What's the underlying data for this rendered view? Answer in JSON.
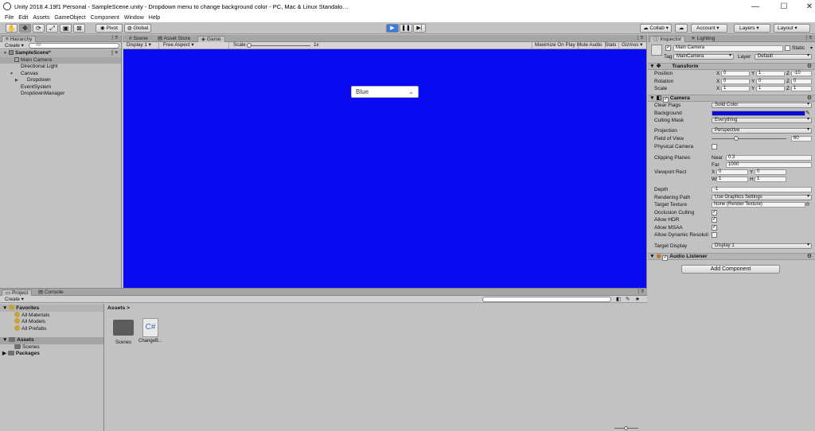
{
  "window": {
    "title": "Unity 2018.4.19f1 Personal - SampleScene.unity - Dropdown menu to change background color - PC, Mac & Linux Standalone* <DX11>",
    "minimize": "—",
    "maximize": "☐",
    "close": "✕"
  },
  "menu": [
    "File",
    "Edit",
    "Assets",
    "GameObject",
    "Component",
    "Window",
    "Help"
  ],
  "toolbar": {
    "pivot": "Pivot",
    "global": "Global",
    "collab": "Collab ▾",
    "account": "Account",
    "layers": "Layers",
    "layout": "Layout",
    "tools": [
      "hand-icon",
      "move-icon",
      "rotate-icon",
      "scale-icon",
      "rect-icon",
      "transform-icon"
    ]
  },
  "hierarchy": {
    "tab": "Hierarchy",
    "create": "Create ▾",
    "search_placeholder": "All",
    "items": [
      {
        "label": "SampleScene*",
        "indent": 0,
        "type": "scene"
      },
      {
        "label": "Main Camera",
        "indent": 1,
        "type": "selected"
      },
      {
        "label": "Directional Light",
        "indent": 1,
        "type": "normal"
      },
      {
        "label": "Canvas",
        "indent": 1,
        "type": "normal"
      },
      {
        "label": "Dropdown",
        "indent": 2,
        "type": "normal"
      },
      {
        "label": "EventSystem",
        "indent": 1,
        "type": "normal"
      },
      {
        "label": "DropdownManager",
        "indent": 1,
        "type": "normal"
      }
    ]
  },
  "scene_tabs": {
    "scene": "Scene",
    "asset_store": "Asset Store",
    "game": "Game"
  },
  "game_bar": {
    "display": "Display 1",
    "aspect": "Free Aspect",
    "scale_label": "Scale",
    "scale_value": "1x",
    "maximize": "Maximize On Play",
    "mute": "Mute Audio",
    "stats": "Stats",
    "gizmos": "Gizmos"
  },
  "game": {
    "background_color": "#0a0af0",
    "dropdown_value": "Blue"
  },
  "inspector": {
    "tab": "Inspector",
    "lighting_tab": "Lighting",
    "object_name": "Main Camera",
    "static_label": "Static",
    "tag_label": "Tag",
    "tag_value": "MainCamera",
    "layer_label": "Layer",
    "layer_value": "Default",
    "transform": {
      "title": "Transform",
      "position_label": "Position",
      "position": [
        "0",
        "1",
        "-10"
      ],
      "rotation_label": "Rotation",
      "rotation": [
        "0",
        "0",
        "0"
      ],
      "scale_label": "Scale",
      "scale": [
        "1",
        "1",
        "1"
      ]
    },
    "camera": {
      "title": "Camera",
      "clear_flags_label": "Clear Flags",
      "clear_flags": "Solid Color",
      "background_label": "Background",
      "background_color": "#0a0ad8",
      "culling_mask_label": "Culling Mask",
      "culling_mask": "Everything",
      "projection_label": "Projection",
      "projection": "Perspective",
      "fov_label": "Field of View",
      "fov": "60",
      "fov_fraction": 0.33,
      "physical_label": "Physical Camera",
      "clipping_label": "Clipping Planes",
      "near_label": "Near",
      "near": "0.3",
      "far_label": "Far",
      "far": "1000",
      "viewport_label": "Viewport Rect",
      "vx": "0",
      "vy": "0",
      "vw": "1",
      "vh": "1",
      "depth_label": "Depth",
      "depth": "-1",
      "rendering_label": "Rendering Path",
      "rendering": "Use Graphics Settings",
      "target_texture_label": "Target Texture",
      "target_texture": "None (Render Texture)",
      "occlusion_label": "Occlusion Culling",
      "hdr_label": "Allow HDR",
      "msaa_label": "Allow MSAA",
      "dynres_label": "Allow Dynamic Resoluti",
      "target_display_label": "Target Display",
      "target_display": "Display 1"
    },
    "audio_listener": "Audio Listener",
    "add_component": "Add Component"
  },
  "project": {
    "tab": "Project",
    "console_tab": "Console",
    "create": "Create ▾",
    "favorites": "Favorites",
    "fav_items": [
      "All Materials",
      "All Models",
      "All Prefabs"
    ],
    "assets_root": "Assets",
    "scenes_folder": "Scenes",
    "packages": "Packages",
    "breadcrumb": "Assets >",
    "assets": [
      {
        "label": "Scenes",
        "kind": "folder"
      },
      {
        "label": "ChangeB...",
        "kind": "script"
      }
    ]
  }
}
